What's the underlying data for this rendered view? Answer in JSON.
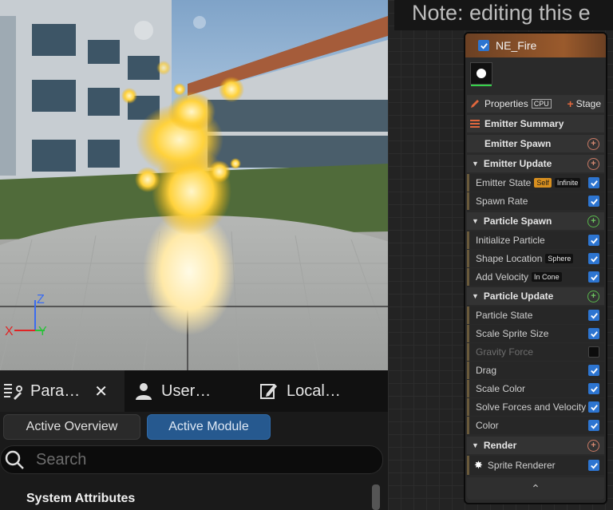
{
  "viewport": {
    "axis_labels": {
      "z": "Z",
      "x": "X",
      "y": "Y"
    },
    "colors": {
      "axis_x": "#e02424",
      "axis_y": "#29c238",
      "axis_z": "#3b6cf0"
    }
  },
  "tabs": [
    {
      "label": "Para…",
      "icon": "parameters-icon",
      "active": true,
      "close": "✕"
    },
    {
      "label": "User…",
      "icon": "user-icon",
      "active": false
    },
    {
      "label": "Local…",
      "icon": "local-edit-icon",
      "active": false
    }
  ],
  "toggles": {
    "overview": "Active Overview",
    "module": "Active Module"
  },
  "search": {
    "placeholder": "Search"
  },
  "section": {
    "title": "System Attributes"
  },
  "note": {
    "text": "Note: editing this e"
  },
  "node": {
    "title": "NE_Fire",
    "properties_label": "Properties",
    "cpu_label": "CPU",
    "stage_label": "Stage",
    "emitter_summary": "Emitter Summary",
    "emitter_spawn": "Emitter Spawn",
    "emitter_update": "Emitter Update",
    "emitter_state": "Emitter State",
    "self_tag": "Self",
    "infinite_tag": "Infinite",
    "spawn_rate": "Spawn Rate",
    "particle_spawn": "Particle Spawn",
    "initialize_particle": "Initialize Particle",
    "shape_location": "Shape Location",
    "sphere_tag": "Sphere",
    "add_velocity": "Add Velocity",
    "in_cone_tag": "In Cone",
    "particle_update": "Particle Update",
    "particle_state": "Particle State",
    "scale_sprite_size": "Scale Sprite Size",
    "gravity_force": "Gravity Force",
    "drag": "Drag",
    "scale_color": "Scale Color",
    "solve_forces": "Solve Forces and Velocity",
    "color": "Color",
    "render": "Render",
    "sprite_renderer": "Sprite Renderer",
    "collapse": "⌃"
  },
  "colors": {
    "accent_blue": "#2d75d1",
    "node_header": "#9a5a2c",
    "add_green": "#58b54c",
    "add_red": "#c97a65"
  }
}
